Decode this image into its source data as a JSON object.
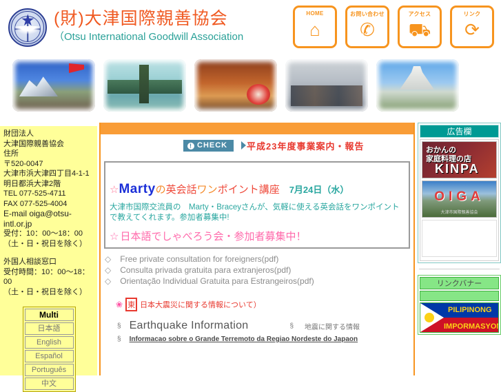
{
  "header": {
    "title_jp": "(財)大津国際親善協会",
    "title_en_lead": "（",
    "title_en": "Otsu International Goodwill Association",
    "logo_alt": "oiga-logo"
  },
  "nav": [
    {
      "label": "HOME",
      "icon": "house-icon",
      "glyph": "⌂"
    },
    {
      "label": "お問い合わせ",
      "icon": "phone-icon",
      "glyph": "✆"
    },
    {
      "label": "アクセス",
      "icon": "car-icon",
      "glyph": "⛟"
    },
    {
      "label": "リンク",
      "icon": "refresh-link-icon",
      "glyph": "⟳"
    }
  ],
  "photos": [
    {
      "name": "photo-mountain-group"
    },
    {
      "name": "photo-lake-pagoda"
    },
    {
      "name": "photo-cultural-festival"
    },
    {
      "name": "photo-european-street-group"
    },
    {
      "name": "photo-capitol-building"
    }
  ],
  "sidebar_left": {
    "contact_lines": [
      "財団法人",
      "大津国際親善協会",
      "住所",
      "〒520-0047",
      "大津市浜大津四丁目4-1-1",
      "明日都浜大津2階",
      "TEL  077-525-4711",
      "FAX  077-525-4004",
      "E-mail oiga@otsu-intl.or.jp",
      "受付：10：00～18：00",
      "（土・日・祝日を除く）"
    ],
    "contact_lines2": [
      "外国人相談窓口",
      "受付時間：10：00～18：00",
      "（土・日・祝日を除く）"
    ],
    "languages": [
      {
        "label": "Multi",
        "active": true
      },
      {
        "label": "日本語",
        "active": false
      },
      {
        "label": "English",
        "active": false
      },
      {
        "label": "Español",
        "active": false
      },
      {
        "label": "Português",
        "active": false
      },
      {
        "label": "中文",
        "active": false
      }
    ]
  },
  "main": {
    "check_badge": "CHECK",
    "check_icon": "!",
    "check_text": "平成23年度事業案内・報告",
    "announcement": {
      "star": "☆",
      "name": "Marty",
      "part_orange_1": "の",
      "part_red_1": "英会話",
      "part_orange_2": "ワン",
      "part_red_2": "ポイント講座",
      "date": "7月24日（水）",
      "body": "大津市国際交流員の　Marty・Braceyさんが、気軽に使える英会話をワンポイントで教えてくれます。参加者募集中!",
      "pink_line_star": "☆",
      "pink_line": "日本語でしゃべろう会・参加者募集中！"
    },
    "pdf_links": [
      {
        "bullet": "◇",
        "sep": "　",
        "label": "Free private consultation for foreigners(pdf)"
      },
      {
        "bullet": "◇",
        "sep": "　",
        "label": "Consulta privada gratuita para extranjeros(pdf)"
      },
      {
        "bullet": "◇",
        "sep": "　",
        "label": "Orientação Individual Gratuita para Estrangeiros(pdf)"
      }
    ],
    "red_notice": {
      "flower": "❀",
      "boxed": "東",
      "text": "日本大震災に関する情報について）"
    },
    "earthquake": {
      "section_mark": "§",
      "title": "Earthquake Information",
      "section_mark_2": "§",
      "jp_label": "地震に関する情報",
      "pt_section_mark": "§",
      "pt_link": "Informacao sobre o Grande Terremoto da Regiao Nordeste do Japaon"
    }
  },
  "sidebar_right": {
    "panel1_title": "広告欄",
    "banners": [
      {
        "name": "banner-kinpa",
        "line1": "おかんの",
        "line2": "家庭料理の店",
        "line3": "KINPA"
      },
      {
        "name": "banner-oiga",
        "text": "OIGA",
        "sub": "大津市国際親善協会"
      }
    ],
    "panel2_title": "リンクバナー",
    "ph_banner": {
      "line1": "PILIPINONG",
      "line2": "IMPORMASYON"
    }
  },
  "colors": {
    "orange": "#f7941e",
    "orange_bar": "#f99d37",
    "yellow_sidebar": "#ffff99",
    "teal": "#009a94",
    "check_blue": "#4c8aa6",
    "red": "#e8392f",
    "pink": "#ff6aab",
    "blue_name": "#1b2fd8",
    "green": "#86e686"
  }
}
